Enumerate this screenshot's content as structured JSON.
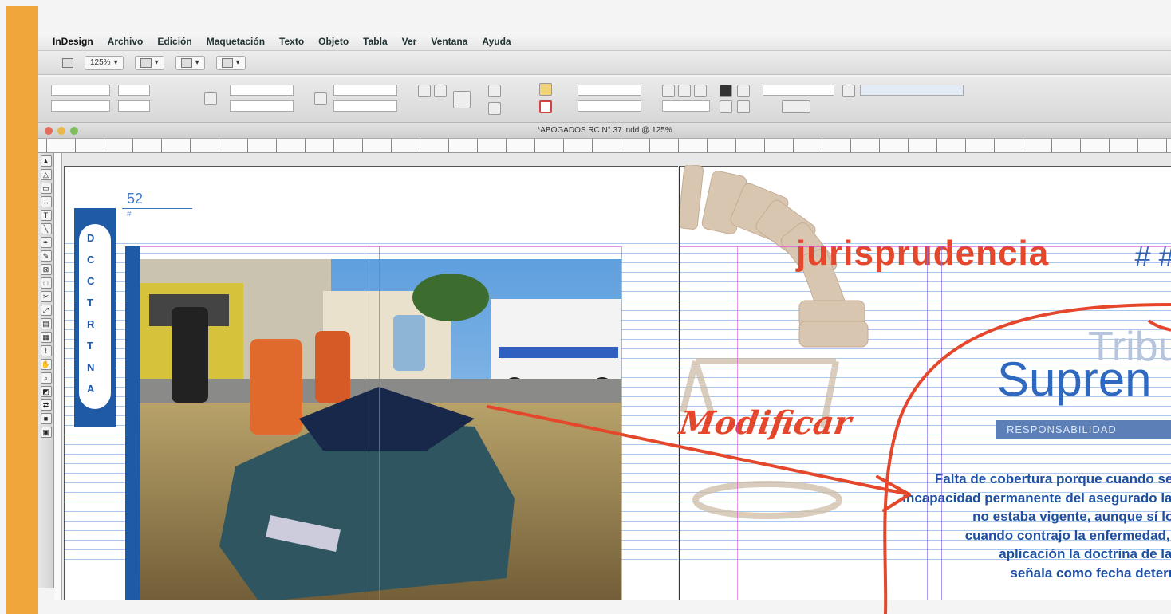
{
  "menubar": {
    "app_name": "InDesign",
    "items": [
      "Archivo",
      "Edición",
      "Maquetación",
      "Texto",
      "Objeto",
      "Tabla",
      "Ver",
      "Ventana",
      "Ayuda"
    ]
  },
  "control_bar": {
    "zoom": "125%"
  },
  "document": {
    "title": "*ABOGADOS RC N° 37.indd @ 125%"
  },
  "page_left": {
    "page_number": "52",
    "tab_letters": [
      "D",
      "C",
      "C",
      "T",
      "R",
      "T",
      "N",
      "A"
    ]
  },
  "page_right": {
    "heading": "jurisprudencia",
    "heading_hashes": "#  #",
    "court_line1": "Tribuna",
    "court_line2": "Supren",
    "category": "RESPONSABILIDAD",
    "annotation": "Modificar",
    "body_lines": [
      "Falta de cobertura porque cuando se de",
      "incapacidad permanente del asegurado la po",
      "no estaba vigente, aunque sí lo es",
      "cuando contrajo la enfermedad, sie",
      "aplicación la doctrina de la Sa",
      "señala como fecha determin"
    ]
  },
  "colors": {
    "accent_blue": "#1f5aa6",
    "heading_red": "#e4472b",
    "tape_orange": "#f0a63a"
  }
}
